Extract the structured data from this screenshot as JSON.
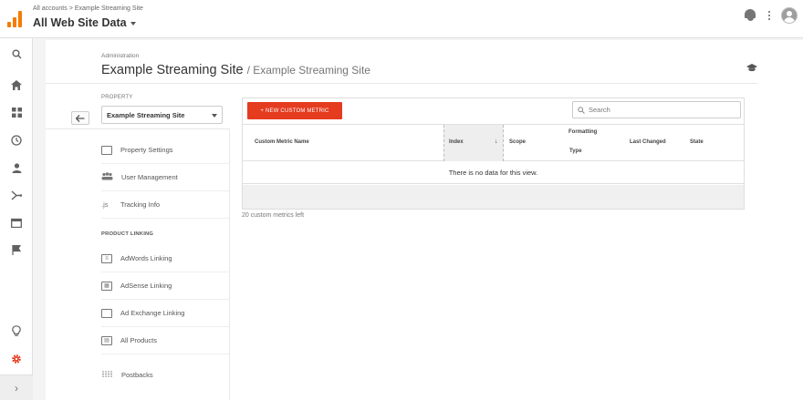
{
  "header": {
    "breadcrumb": {
      "accounts": "All accounts",
      "separator": ">",
      "site": "Example Streaming Site"
    },
    "title": "All Web Site Data"
  },
  "admin": {
    "label": "Administration",
    "title": "Example Streaming Site",
    "subtitle": "/ Example Streaming Site"
  },
  "property": {
    "label": "PROPERTY",
    "selected": "Example Streaming Site"
  },
  "menu": [
    {
      "label": "Property Settings",
      "icon": "property-settings-icon"
    },
    {
      "label": "User Management",
      "icon": "users-icon"
    },
    {
      "label": "Tracking Info",
      "icon": "js-icon",
      "glyph": ".js"
    }
  ],
  "product_linking": {
    "label": "PRODUCT LINKING",
    "items": [
      {
        "label": "AdWords Linking",
        "icon": "adwords-icon"
      },
      {
        "label": "AdSense Linking",
        "icon": "adsense-icon"
      },
      {
        "label": "Ad Exchange Linking",
        "icon": "ad-exchange-icon"
      },
      {
        "label": "All Products",
        "icon": "all-products-icon"
      }
    ]
  },
  "more": [
    {
      "label": "Postbacks",
      "icon": "postbacks-icon"
    }
  ],
  "table": {
    "new_button": "+ NEW CUSTOM METRIC",
    "search_placeholder": "Search",
    "columns": {
      "name": "Custom Metric Name",
      "index": "Index",
      "scope": "Scope",
      "formatting": "Formatting",
      "type": "Type",
      "last_changed": "Last Changed",
      "state": "State"
    },
    "empty_message": "There is no data for this view.",
    "remaining": "20 custom metrics left"
  },
  "colors": {
    "accent": "#e53b1f",
    "logo": "#f57c00"
  }
}
